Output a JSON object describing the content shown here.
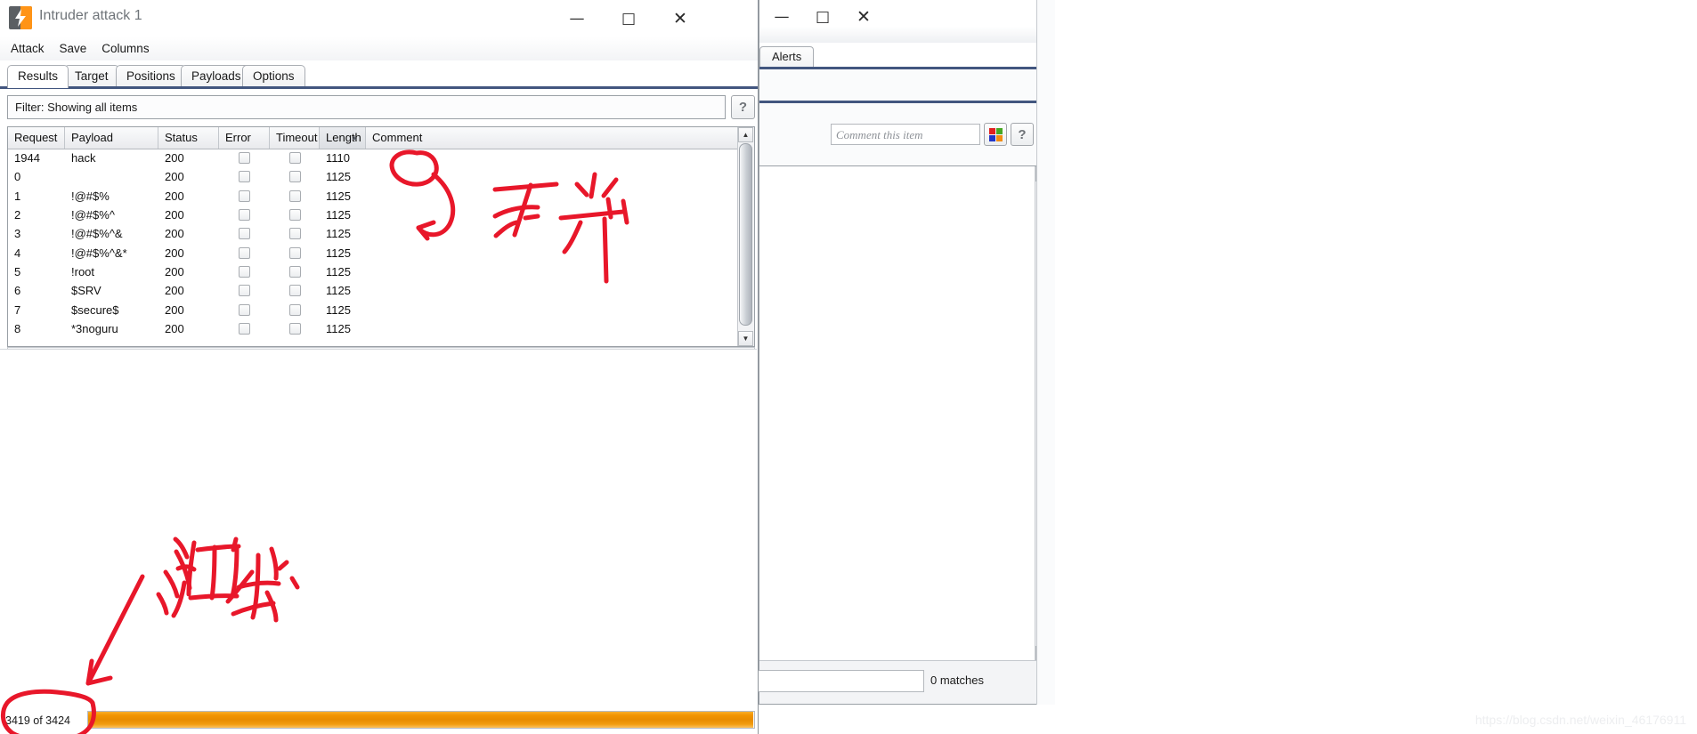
{
  "left_window": {
    "title": "Intruder attack 1",
    "logo_icon": "burp-suite-logo-icon",
    "controls": {
      "minimize": "—",
      "maximize": "□",
      "close": "✕"
    },
    "menu": [
      "Attack",
      "Save",
      "Columns"
    ],
    "tabs": [
      {
        "label": "Results",
        "active": true
      },
      {
        "label": "Target",
        "active": false
      },
      {
        "label": "Positions",
        "active": false
      },
      {
        "label": "Payloads",
        "active": false
      },
      {
        "label": "Options",
        "active": false
      }
    ],
    "filter": {
      "text": "Filter: Showing all items",
      "help_label": "?"
    },
    "table": {
      "columns": [
        "Request",
        "Payload",
        "Status",
        "Error",
        "Timeout",
        "Length",
        "Comment"
      ],
      "sorted_column": "Length",
      "sort_arrow": "▲",
      "rows": [
        {
          "request": "1944",
          "payload": "hack",
          "status": "200",
          "error": false,
          "timeout": false,
          "length": "1110",
          "comment": ""
        },
        {
          "request": "0",
          "payload": "",
          "status": "200",
          "error": false,
          "timeout": false,
          "length": "1125",
          "comment": ""
        },
        {
          "request": "1",
          "payload": "!@#$%",
          "status": "200",
          "error": false,
          "timeout": false,
          "length": "1125",
          "comment": ""
        },
        {
          "request": "2",
          "payload": "!@#$%^",
          "status": "200",
          "error": false,
          "timeout": false,
          "length": "1125",
          "comment": ""
        },
        {
          "request": "3",
          "payload": "!@#$%^&",
          "status": "200",
          "error": false,
          "timeout": false,
          "length": "1125",
          "comment": ""
        },
        {
          "request": "4",
          "payload": "!@#$%^&*",
          "status": "200",
          "error": false,
          "timeout": false,
          "length": "1125",
          "comment": ""
        },
        {
          "request": "5",
          "payload": "!root",
          "status": "200",
          "error": false,
          "timeout": false,
          "length": "1125",
          "comment": ""
        },
        {
          "request": "6",
          "payload": "$SRV",
          "status": "200",
          "error": false,
          "timeout": false,
          "length": "1125",
          "comment": ""
        },
        {
          "request": "7",
          "payload": "$secure$",
          "status": "200",
          "error": false,
          "timeout": false,
          "length": "1125",
          "comment": ""
        },
        {
          "request": "8",
          "payload": "*3noguru",
          "status": "200",
          "error": false,
          "timeout": false,
          "length": "1125",
          "comment": ""
        }
      ]
    },
    "progress": {
      "label": "3419 of 3424",
      "completed": 3419,
      "total": 3424,
      "bar_color": "#ef9200"
    }
  },
  "right_window": {
    "controls": {
      "minimize": "—",
      "maximize": "□",
      "close": "✕"
    },
    "tabs": [
      {
        "label": "Alerts",
        "active": true
      }
    ],
    "comment_field": {
      "placeholder": "Comment this item",
      "value": ""
    },
    "color_picker_icon": "color-swatch-grid-icon",
    "swatch_colors": [
      "#e02020",
      "#46a722",
      "#2136c8",
      "#f28c12"
    ],
    "help_label": "?",
    "footer": {
      "search_value": "",
      "matches_label": "0 matches"
    }
  },
  "annotations": {
    "circle_length": "1110",
    "note_top": "不一样",
    "note_bottom": "测试",
    "circle_progress": "3419 of 3424",
    "ink_color": "#e8172a"
  },
  "watermark": {
    "text": "https://blog.csdn.net/weixin_46176911"
  }
}
